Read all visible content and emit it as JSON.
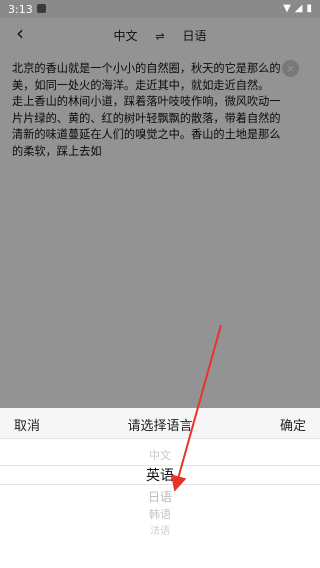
{
  "status_bar": {
    "time": "3:13",
    "right": [
      "▼",
      "◢",
      "▮"
    ]
  },
  "header": {
    "source_lang": "中文",
    "swap_symbol": "⇌",
    "target_lang": "日语",
    "back_icon": "‹"
  },
  "input": {
    "text": "北京的香山就是一个小小的自然圈，秋天的它是那么的美，如同一处火的海洋。走近其中，就如走近自然。\n走上香山的林间小道，踩着落叶吱吱作响，微风吹动一片片绿的、黄的、红的树叶轻飘飘的散落，带着自然的清新的味道蔓延在人们的嗅觉之中。香山的土地是那么的柔软，踩上去如",
    "clear_icon": "×"
  },
  "sheet": {
    "cancel": "取消",
    "title": "请选择语言",
    "confirm": "确定",
    "options": [
      "中文",
      "英语",
      "日语",
      "韩语",
      "法语"
    ],
    "selected_index": 1
  },
  "annotation": {
    "arrow_color": "#e8332a"
  }
}
